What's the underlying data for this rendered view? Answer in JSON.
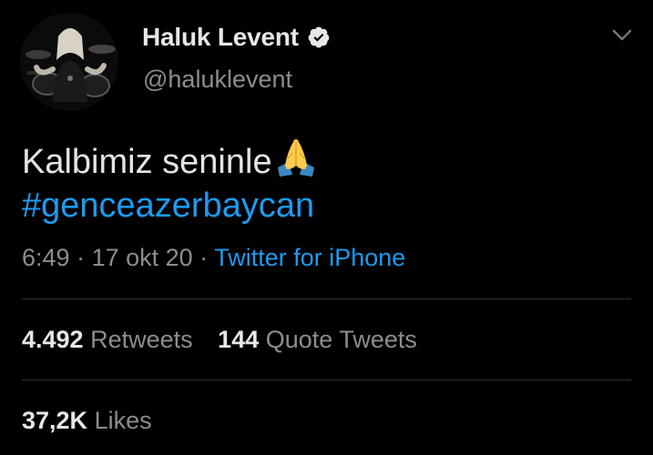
{
  "user": {
    "display_name": "Haluk Levent",
    "handle": "@haluklevent",
    "verified": true,
    "avatar_alt": "profile photo"
  },
  "tweet": {
    "text": "Kalbimiz seninle",
    "emoji": "folded-hands-emoji",
    "hashtag": "#genceazerbaycan",
    "time": "6:49",
    "date": "17 okt 20",
    "separator": "·",
    "source": "Twitter for iPhone"
  },
  "stats": {
    "retweets_count": "4.492",
    "retweets_label": "Retweets",
    "quotes_count": "144",
    "quotes_label": "Quote Tweets",
    "likes_count": "37,2K",
    "likes_label": "Likes"
  },
  "icons": {
    "verified": "verified-badge-icon",
    "more": "chevron-down-icon"
  },
  "colors": {
    "background": "#000000",
    "link": "#1d9bf0",
    "secondary_text": "#8a8d91",
    "divider": "#2f3336"
  }
}
